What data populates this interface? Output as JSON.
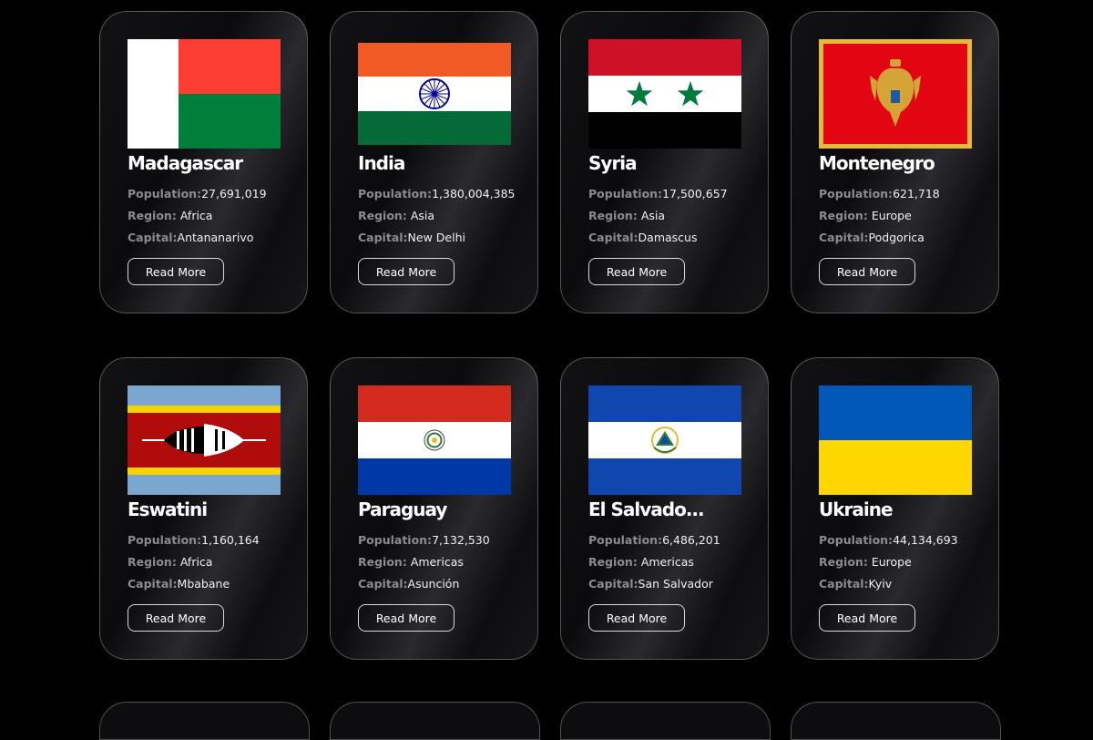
{
  "labels": {
    "population": "Population:",
    "region": "Region:",
    "capital": "Capital:",
    "read_more": "Read More"
  },
  "cards": [
    {
      "name": "Madagascar",
      "population": "27,691,019",
      "region": "Africa",
      "capital": "Antananarivo"
    },
    {
      "name": "India",
      "population": "1,380,004,385",
      "region": "Asia",
      "capital": "New Delhi"
    },
    {
      "name": "Syria",
      "population": "17,500,657",
      "region": "Asia",
      "capital": "Damascus"
    },
    {
      "name": "Montenegro",
      "population": "621,718",
      "region": "Europe",
      "capital": "Podgorica"
    },
    {
      "name": "Eswatini",
      "population": "1,160,164",
      "region": "Africa",
      "capital": "Mbabane"
    },
    {
      "name": "Paraguay",
      "population": "7,132,530",
      "region": "Americas",
      "capital": "Asunción"
    },
    {
      "name": "El Salvado...",
      "population": "6,486,201",
      "region": "Americas",
      "capital": "San Salvador"
    },
    {
      "name": "Ukraine",
      "population": "44,134,693",
      "region": "Europe",
      "capital": "Kyiv"
    }
  ],
  "colors": {
    "background": "#000000",
    "card_border": "#4a4a4a",
    "label_gray": "#8c8c8c",
    "button_border": "#d9d9d9"
  },
  "icons": [
    "madagascar-flag-icon",
    "india-flag-icon",
    "syria-flag-icon",
    "montenegro-flag-icon",
    "eswatini-flag-icon",
    "paraguay-flag-icon",
    "el-salvador-flag-icon",
    "ukraine-flag-icon"
  ]
}
